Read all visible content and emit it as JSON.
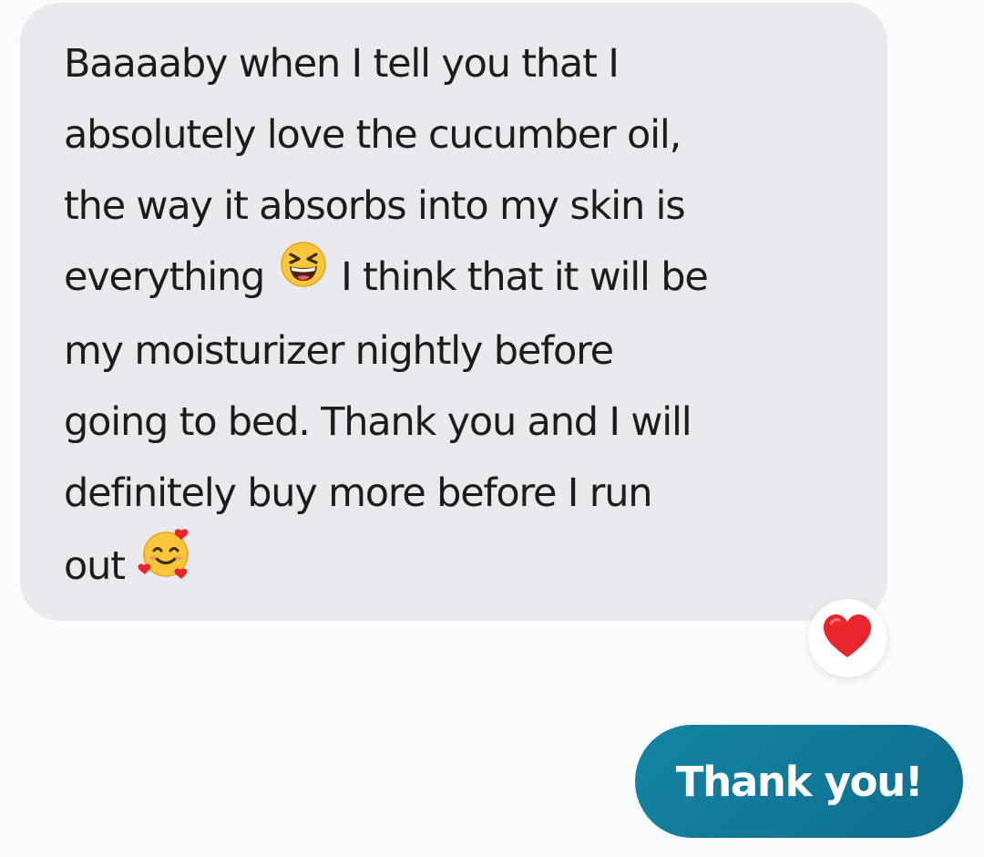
{
  "conversation": {
    "incoming_message": {
      "lines": [
        "Baaaaby when I tell you that I",
        "absolutely love the cucumber oil,",
        "the way it absorbs into my skin is",
        "everything",
        "I think that it will be",
        "my moisturizer nightly before",
        "going to bed. Thank you and I will",
        "definitely buy more before I run",
        "out"
      ],
      "emojis": [
        "grinning-squinting-face-emoji",
        "smiling-face-with-hearts-emoji"
      ],
      "bubble_color": "#e7e9ec",
      "text_color": "#1c1c1e",
      "reaction": {
        "icon": "red-heart-icon",
        "color": "#e8262b"
      }
    },
    "outgoing_message": {
      "text": "Thank you!",
      "bubble_color": "#1585a4",
      "text_color": "#ffffff"
    },
    "background_color": "#fbfbfd"
  }
}
